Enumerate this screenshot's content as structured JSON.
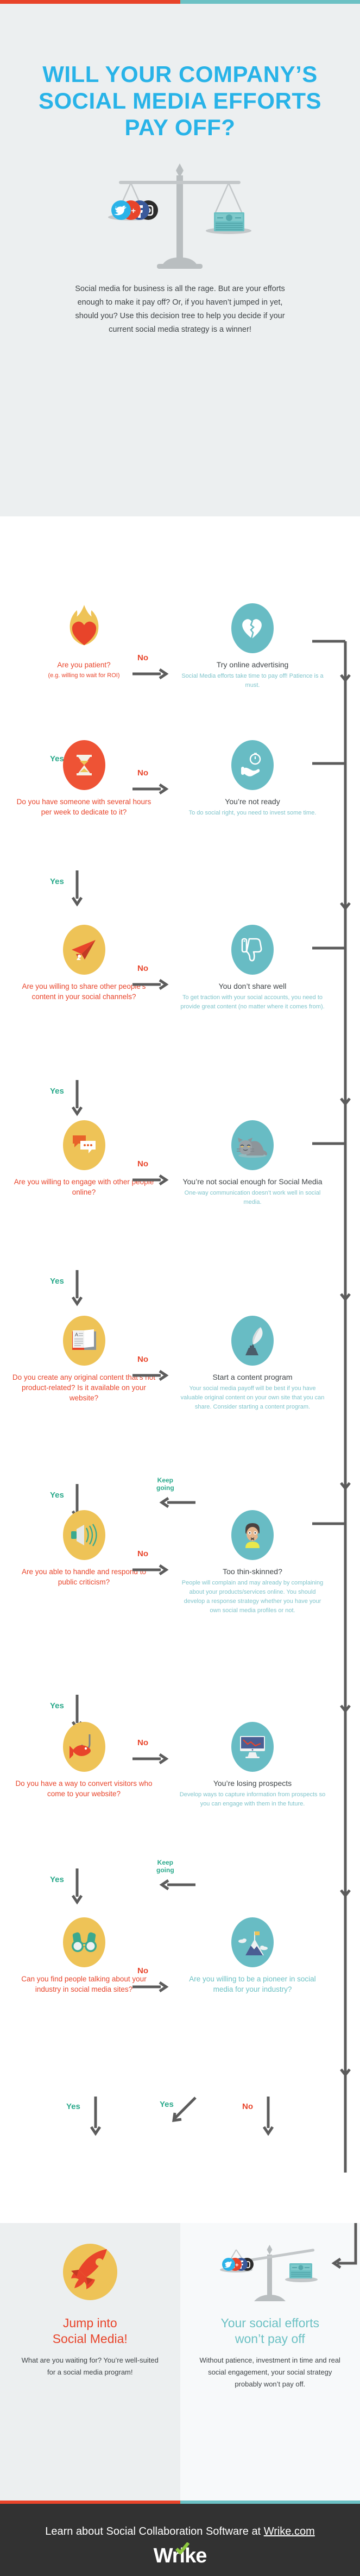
{
  "theme": {
    "red": "#e8442a",
    "teal": "#6cc1c4",
    "blue_title": "#28b3e8",
    "yellow": "#eec357",
    "green_yes": "#2aa98b",
    "dark": "#323232",
    "bg_grey": "#eceff0"
  },
  "hero": {
    "title_line1": "WILL YOUR COMPANY’S",
    "title_line2": "SOCIAL MEDIA EFFORTS",
    "title_line3": "PAY OFF?",
    "illustration": "balance-scale-social-vs-money",
    "intro": "Social media for business is all the rage. But are your efforts enough to make it pay off? Or, if you haven’t jumped in yet, should you? Use this decision tree to help you decide if your current social media strategy is a winner!"
  },
  "labels": {
    "no": "No",
    "yes": "Yes",
    "keep_going_l1": "Keep",
    "keep_going_l2": "going"
  },
  "steps": [
    {
      "id": "patience",
      "question_icon": "flaming-heart-icon",
      "question": "Are you patient?",
      "question_sub": "(e.g. willing to wait for ROI)",
      "answer_icon": "broken-heart-icon",
      "answer_title": "Try online advertising",
      "answer_body": "Social Media efforts take time to pay off! Patience is a must."
    },
    {
      "id": "time",
      "question_icon": "hourglass-icon",
      "question": "Do you have someone with several hours per week to dedicate to it?",
      "question_sub": "",
      "answer_icon": "hand-holding-stopwatch-icon",
      "answer_title": "You’re not ready",
      "answer_body": "To do social right, you need to invest some time."
    },
    {
      "id": "sharing",
      "question_icon": "paper-plane-icon",
      "question": "Are you willing to share other people’s content in your social channels?",
      "question_sub": "",
      "answer_icon": "thumbs-down-icon",
      "answer_title": "You don’t share well",
      "answer_body": "To get traction with your social accounts, you need to provide great content (no matter where it comes from)."
    },
    {
      "id": "engagement",
      "question_icon": "speech-bubbles-icon",
      "question": "Are you willing to engage with other people online?",
      "question_sub": "",
      "answer_icon": "grumpy-cat-icon",
      "answer_title": "You’re not social enough for Social Media",
      "answer_body": "One-way communication doesn’t work well in social media."
    },
    {
      "id": "content",
      "question_icon": "open-book-icon",
      "question": "Do you create any original content that’s not product-related? Is it available on your website?",
      "question_sub": "",
      "answer_icon": "quill-and-inkwell-icon",
      "answer_title": "Start a content program",
      "answer_body": "Your social media payoff will be best if you have valuable original content on your own site that you can share. Consider starting a content program."
    },
    {
      "id": "criticism",
      "question_icon": "megaphone-icon",
      "question": "Are you able to handle and respond to public criticism?",
      "question_sub": "",
      "answer_icon": "crying-face-icon",
      "answer_title": "Too thin-skinned?",
      "answer_body": "People will complain and may already by complaining about your products/services online. You should develop a response strategy whether you have your own social media profiles or not."
    },
    {
      "id": "conversion",
      "question_icon": "fish-hook-icon",
      "question": "Do you have a way to convert visitors who come to your website?",
      "question_sub": "",
      "answer_icon": "declining-chart-monitor-icon",
      "answer_title": "You’re losing prospects",
      "answer_body": "Develop ways to capture information from prospects so you can engage with them in the future."
    },
    {
      "id": "listening",
      "question_icon": "binoculars-icon",
      "question": "Can you find people talking about your industry in social media sites?",
      "question_sub": "",
      "answer_icon": "mountain-flag-icon",
      "answer_title": "Are you willing to be a pioneer in social media for your industry?",
      "answer_body": ""
    }
  ],
  "results": {
    "positive": {
      "icon": "rocket-icon",
      "title_line1": "Jump into",
      "title_line2": "Social Media!",
      "body": "What are you waiting for? You’re well-suited for a social media program!"
    },
    "negative": {
      "icon": "tipped-balance-scale-icon",
      "title_line1": "Your social efforts",
      "title_line2": "won’t pay off",
      "body": "Without patience, investment in time and real social engagement, your social strategy probably won’t pay off."
    }
  },
  "footer": {
    "cta_prefix": "Learn about Social Collaboration Software at ",
    "cta_link": "Wrike.com",
    "logo": "Wrike"
  }
}
